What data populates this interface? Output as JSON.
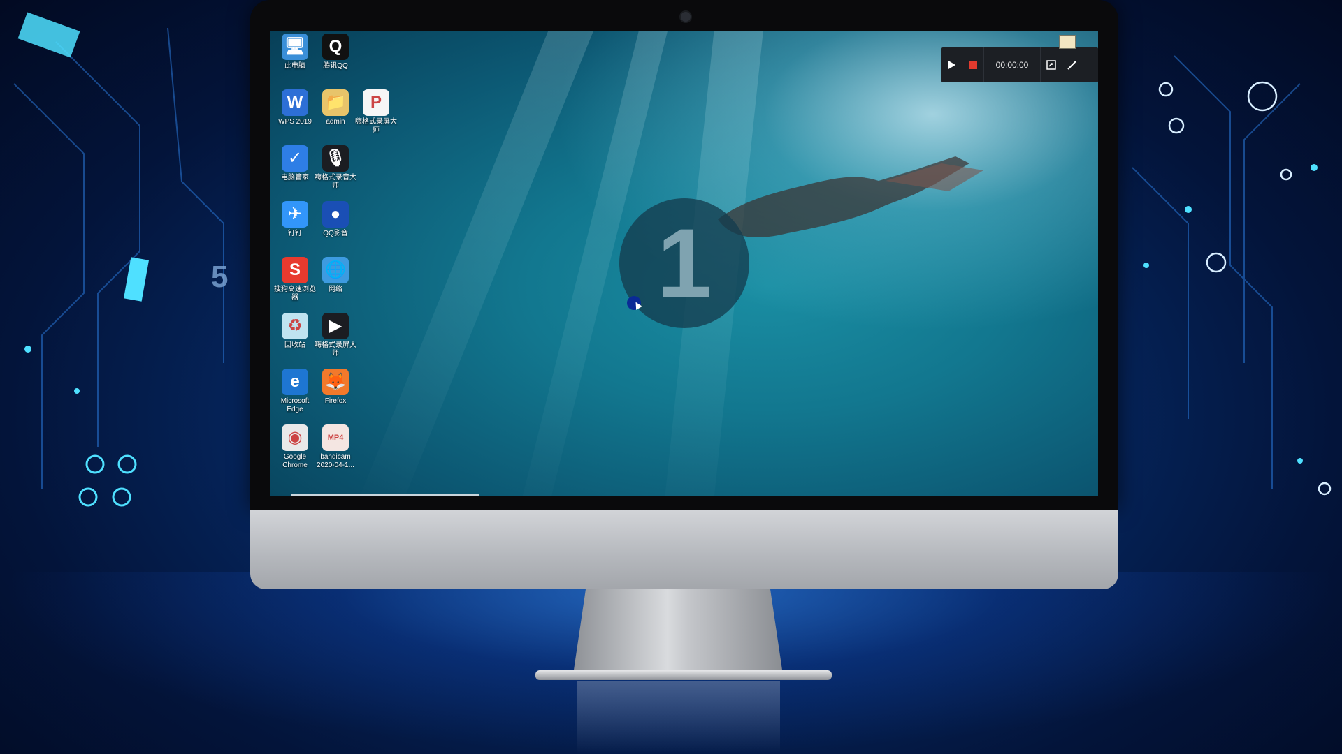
{
  "side_number": "5",
  "desktop": {
    "icons": [
      {
        "label": "此电脑",
        "icon": "computer-icon",
        "color": "#3a8fd8",
        "glyph": "🖥"
      },
      {
        "label": "腾讯QQ",
        "icon": "qq-penguin-icon",
        "color": "#111111",
        "glyph": "Q"
      },
      {
        "label": "WPS 2019",
        "icon": "wps-icon",
        "color": "#2d6fd6",
        "glyph": "W"
      },
      {
        "label": "admin",
        "icon": "user-folder-icon",
        "color": "#e8c46a",
        "glyph": "📁"
      },
      {
        "label": "嗨格式录屏大师",
        "icon": "ppt-file-icon",
        "color": "#f6f6f6",
        "glyph": "P"
      },
      {
        "label": "电脑管家",
        "icon": "shield-icon",
        "color": "#2e7ee6",
        "glyph": "✓"
      },
      {
        "label": "嗨格式录音大师",
        "icon": "microphone-icon",
        "color": "#1b1d22",
        "glyph": "🎙"
      },
      {
        "label": "钉钉",
        "icon": "dingtalk-icon",
        "color": "#3296fa",
        "glyph": "✈"
      },
      {
        "label": "QQ影音",
        "icon": "qq-player-icon",
        "color": "#1a4fb5",
        "glyph": "●"
      },
      {
        "label": "搜狗高速浏览器",
        "icon": "sogou-browser-icon",
        "color": "#e83a2e",
        "glyph": "S"
      },
      {
        "label": "网络",
        "icon": "network-icon",
        "color": "#3d9be0",
        "glyph": "🌐"
      },
      {
        "label": "回收站",
        "icon": "recycle-bin-icon",
        "color": "#bfe3f0",
        "glyph": "♻"
      },
      {
        "label": "嗨格式录屏大师",
        "icon": "screen-recorder-icon",
        "color": "#1b1d22",
        "glyph": "▶"
      },
      {
        "label": "Microsoft Edge",
        "icon": "edge-icon",
        "color": "#1e76d2",
        "glyph": "e"
      },
      {
        "label": "Firefox",
        "icon": "firefox-icon",
        "color": "#f2792b",
        "glyph": "🦊"
      },
      {
        "label": "Google Chrome",
        "icon": "chrome-icon",
        "color": "#e9e9e9",
        "glyph": "◉"
      },
      {
        "label": "bandicam 2020-04-1...",
        "icon": "mp4-file-icon",
        "color": "#f4e6e2",
        "glyph": "MP4"
      }
    ]
  },
  "countdown": "1",
  "recorder_toolbar": {
    "time": "00:00:00",
    "play_icon": "play-icon",
    "stop_icon": "stop-icon",
    "screenshot_icon": "screenshot-icon",
    "pen_icon": "pen-icon",
    "stop_color": "#e03a2e"
  }
}
